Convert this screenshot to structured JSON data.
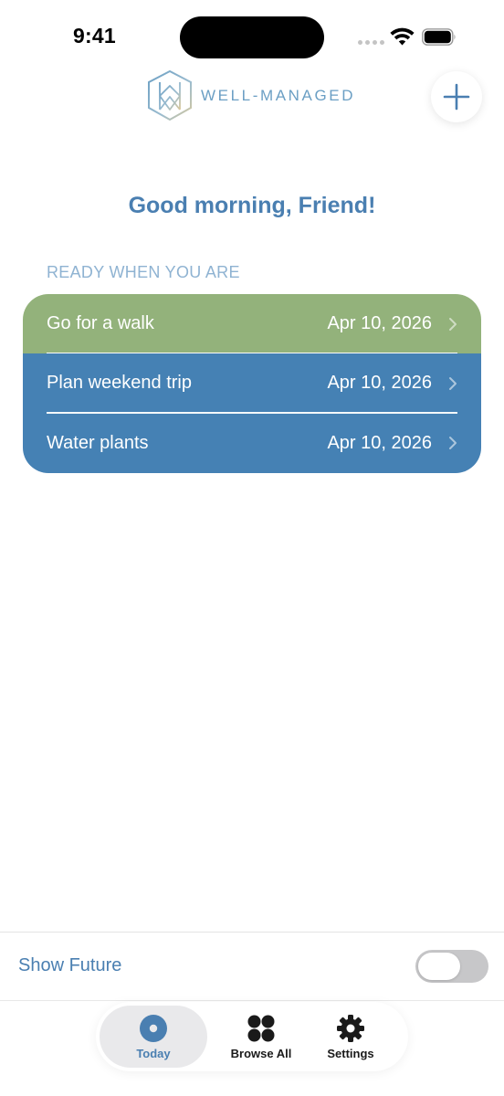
{
  "status_bar": {
    "time": "9:41"
  },
  "header": {
    "brand": "WELL-MANAGED"
  },
  "greeting": "Good morning, Friend!",
  "section_label": "READY WHEN YOU ARE",
  "tasks": [
    {
      "name": "Go for a walk",
      "date": "Apr 10, 2026",
      "color": "#93b27b"
    },
    {
      "name": "Plan weekend trip",
      "date": "Apr 10, 2026",
      "color": "#4581b4"
    },
    {
      "name": "Water plants",
      "date": "Apr 10, 2026",
      "color": "#4581b4"
    }
  ],
  "show_future": {
    "label": "Show Future",
    "enabled": false
  },
  "tabs": [
    {
      "label": "Today",
      "icon": "today-icon",
      "active": true
    },
    {
      "label": "Browse All",
      "icon": "grid-icon",
      "active": false
    },
    {
      "label": "Settings",
      "icon": "gear-icon",
      "active": false
    }
  ],
  "colors": {
    "accent": "#4a7fb1",
    "green": "#93b27b",
    "blue": "#4581b4"
  }
}
